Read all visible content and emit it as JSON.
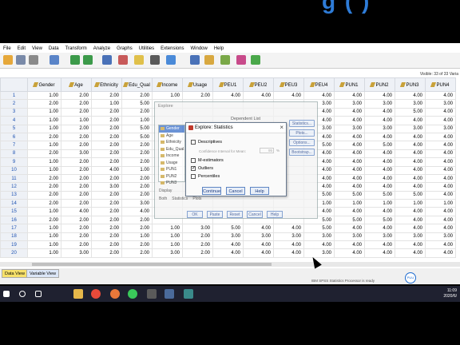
{
  "app": {
    "menu": [
      "File",
      "Edit",
      "View",
      "Data",
      "Transform",
      "Analyze",
      "Graphs",
      "Utilities",
      "Extensions",
      "Window",
      "Help"
    ],
    "visible_info": "Visible: 33 of 33 Varia",
    "status_text": "IBM SPSS Statistics Processor is ready",
    "status_bulb": "PUU",
    "tabs": {
      "data_view": "Data View",
      "variable_view": "Variable View"
    }
  },
  "grid": {
    "columns": [
      "Gender",
      "Age",
      "Ethnicity",
      "Edu_Qual",
      "Income",
      "Usage",
      "PEU1",
      "PEU2",
      "PEU3",
      "PEU4",
      "PUN1",
      "PUN2",
      "PUN3",
      "PUN4"
    ],
    "rows": [
      [
        "1",
        "1.00",
        "2.00",
        "2.00",
        "2.00",
        "1.00",
        "2.00",
        "4.00",
        "4.00",
        "4.00",
        "4.00",
        "4.00",
        "4.00",
        "4.00",
        "4.00"
      ],
      [
        "2",
        "2.00",
        "2.00",
        "1.00",
        "5.00",
        "",
        "",
        "",
        "",
        "",
        "3.00",
        "3.00",
        "3.00",
        "3.00",
        "3.00"
      ],
      [
        "3",
        "1.00",
        "2.00",
        "2.00",
        "2.00",
        "",
        "",
        "",
        "",
        "",
        "4.00",
        "4.00",
        "4.00",
        "5.00",
        "4.00"
      ],
      [
        "4",
        "1.00",
        "1.00",
        "2.00",
        "1.00",
        "",
        "",
        "",
        "",
        "",
        "4.00",
        "4.00",
        "4.00",
        "4.00",
        "4.00"
      ],
      [
        "5",
        "1.00",
        "2.00",
        "2.00",
        "5.00",
        "",
        "",
        "",
        "",
        "",
        "3.00",
        "3.00",
        "3.00",
        "3.00",
        "3.00"
      ],
      [
        "6",
        "2.00",
        "2.00",
        "2.00",
        "5.00",
        "",
        "",
        "",
        "",
        "",
        "4.00",
        "4.00",
        "4.00",
        "4.00",
        "4.00"
      ],
      [
        "7",
        "1.00",
        "2.00",
        "2.00",
        "2.00",
        "",
        "",
        "",
        "",
        "",
        "5.00",
        "4.00",
        "5.00",
        "4.00",
        "4.00"
      ],
      [
        "8",
        "2.00",
        "3.00",
        "2.00",
        "2.00",
        "",
        "",
        "",
        "",
        "",
        "4.00",
        "4.00",
        "4.00",
        "4.00",
        "4.00"
      ],
      [
        "9",
        "1.00",
        "2.00",
        "2.00",
        "2.00",
        "",
        "",
        "",
        "",
        "",
        "4.00",
        "4.00",
        "4.00",
        "4.00",
        "4.00"
      ],
      [
        "10",
        "1.00",
        "2.00",
        "4.00",
        "1.00",
        "",
        "",
        "",
        "",
        "",
        "4.00",
        "4.00",
        "4.00",
        "4.00",
        "4.00"
      ],
      [
        "11",
        "2.00",
        "2.00",
        "2.00",
        "2.00",
        "",
        "",
        "",
        "",
        "",
        "4.00",
        "4.00",
        "4.00",
        "4.00",
        "4.00"
      ],
      [
        "12",
        "2.00",
        "2.00",
        "3.00",
        "2.00",
        "",
        "",
        "",
        "",
        "",
        "4.00",
        "4.00",
        "4.00",
        "4.00",
        "4.00"
      ],
      [
        "13",
        "2.00",
        "2.00",
        "2.00",
        "2.00",
        "",
        "",
        "",
        "",
        "",
        "5.00",
        "5.00",
        "5.00",
        "5.00",
        "4.00"
      ],
      [
        "14",
        "2.00",
        "2.00",
        "2.00",
        "3.00",
        "",
        "",
        "",
        "",
        "",
        "1.00",
        "1.00",
        "1.00",
        "1.00",
        "1.00"
      ],
      [
        "15",
        "1.00",
        "4.00",
        "2.00",
        "4.00",
        "",
        "",
        "",
        "",
        "",
        "4.00",
        "4.00",
        "4.00",
        "4.00",
        "4.00"
      ],
      [
        "16",
        "2.00",
        "2.00",
        "2.00",
        "2.00",
        "",
        "",
        "",
        "",
        "",
        "5.00",
        "5.00",
        "5.00",
        "4.00",
        "4.00"
      ],
      [
        "17",
        "1.00",
        "2.00",
        "2.00",
        "2.00",
        "1.00",
        "3.00",
        "5.00",
        "4.00",
        "4.00",
        "5.00",
        "4.00",
        "4.00",
        "4.00",
        "4.00"
      ],
      [
        "18",
        "1.00",
        "2.00",
        "2.00",
        "1.00",
        "1.00",
        "2.00",
        "3.00",
        "3.00",
        "3.00",
        "3.00",
        "3.00",
        "3.00",
        "3.00",
        "3.00"
      ],
      [
        "19",
        "1.00",
        "2.00",
        "2.00",
        "2.00",
        "1.00",
        "2.00",
        "4.00",
        "4.00",
        "4.00",
        "4.00",
        "4.00",
        "4.00",
        "4.00",
        "4.00"
      ],
      [
        "20",
        "1.00",
        "3.00",
        "2.00",
        "2.00",
        "3.00",
        "2.00",
        "4.00",
        "4.00",
        "4.00",
        "3.00",
        "4.00",
        "4.00",
        "4.00",
        "4.00"
      ]
    ]
  },
  "explore_dialog": {
    "title": "Explore",
    "dependent_list_label": "Dependent List",
    "variables": [
      "Gender",
      "Age",
      "Ethnicity",
      "Edu_Qual",
      "Income",
      "Usage",
      "PUN1",
      "PUN2",
      "PUN3"
    ],
    "side_buttons": [
      "Statistics...",
      "Plots...",
      "Options...",
      "Bootstrap..."
    ],
    "display_label": "Display",
    "display_options": [
      "Both",
      "Statistics",
      "Plots"
    ],
    "buttons": [
      "OK",
      "Paste",
      "Reset",
      "Cancel",
      "Help"
    ]
  },
  "stats_dialog": {
    "title": "Explore: Statistics",
    "close": "×",
    "descriptives": {
      "label": "Descriptives",
      "checked": false
    },
    "ci_label": "Confidence Interval for Mean:",
    "ci_value": "95",
    "ci_unit": "%",
    "m_estimators": {
      "label": "M-estimators",
      "checked": false
    },
    "outliers": {
      "label": "Outliers",
      "checked": true
    },
    "percentiles": {
      "label": "Percentiles",
      "checked": false
    },
    "buttons": [
      "Continue",
      "Cancel",
      "Help"
    ]
  },
  "taskbar": {
    "time": "11:09",
    "date": "2020/6/"
  }
}
